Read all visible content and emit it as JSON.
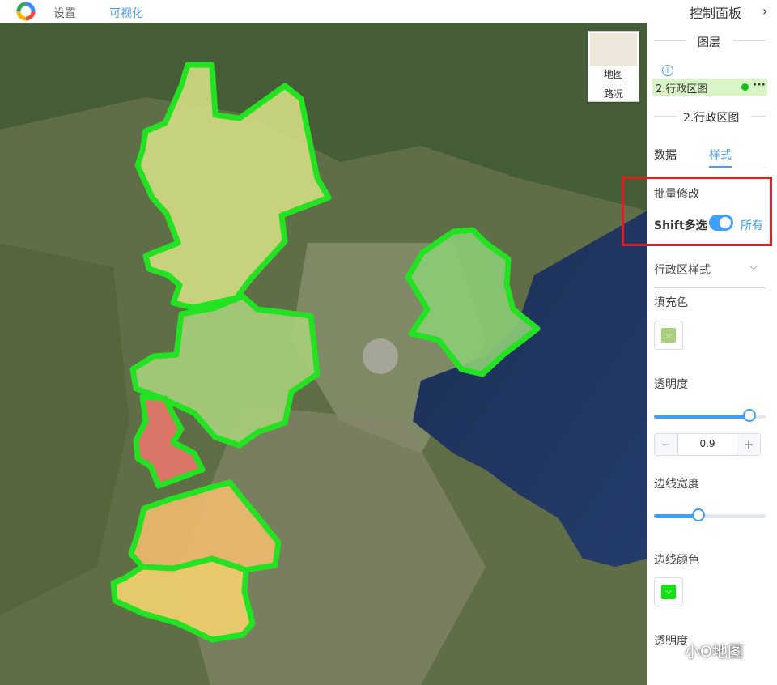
{
  "header": {
    "tabs": [
      {
        "label": "设置"
      },
      {
        "label": "可视化",
        "active": true
      }
    ]
  },
  "basemap": {
    "options": [
      "地图",
      "路况"
    ]
  },
  "panel": {
    "title": "控制面板",
    "layers_section": "图层",
    "layer": {
      "name": "2.行政区图",
      "visible": true
    },
    "layer_detail_title": "2.行政区图",
    "tabs": [
      {
        "label": "数据"
      },
      {
        "label": "样式",
        "active": true
      }
    ],
    "batch_edit": "批量修改",
    "shift_label": "Shift多选",
    "toggle_on": true,
    "toggle_label": "所有",
    "style_dropdown": "行政区样式",
    "fill_color_label": "填充色",
    "fill_color": "#a8cf7a",
    "opacity_label": "透明度",
    "opacity_value": "0.9",
    "stroke_width_label": "边线宽度",
    "stroke_width_fraction": 0.4,
    "stroke_color_label": "边线颜色",
    "stroke_color": "#16e016",
    "opacity_label_2": "透明度"
  },
  "watermark": "小O地图",
  "colors": {
    "accent": "#409eff",
    "highlight": "#e61b1b",
    "boundary": "#22e222"
  }
}
